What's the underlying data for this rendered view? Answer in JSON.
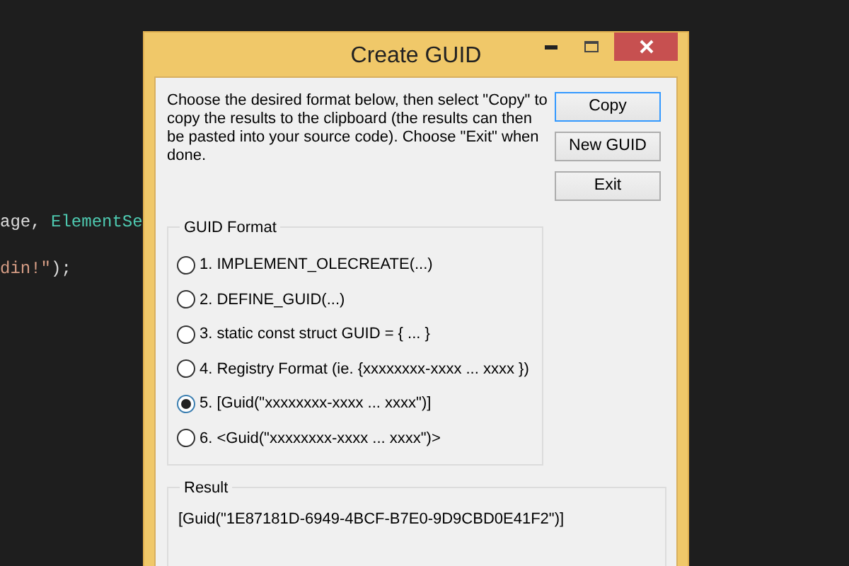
{
  "editor": {
    "lines": [
      {
        "parts": [
          {
            "kind": "plain",
            "text": "age, "
          },
          {
            "kind": "type",
            "text": "ElementSe"
          }
        ]
      },
      {
        "parts": [
          {
            "kind": "string",
            "text": "din!\""
          },
          {
            "kind": "plain",
            "text": ");"
          }
        ]
      }
    ]
  },
  "window": {
    "title": "Create GUID"
  },
  "instructions": "Choose the desired format below, then select \"Copy\" to copy the results to the clipboard (the results can then be pasted into your source code).  Choose \"Exit\" when done.",
  "buttons": [
    {
      "label": "Copy",
      "default": true
    },
    {
      "label": "New GUID",
      "default": false
    },
    {
      "label": "Exit",
      "default": false
    }
  ],
  "guid_format": {
    "title": "GUID Format",
    "options": [
      {
        "label": "1. IMPLEMENT_OLECREATE(...)",
        "selected": false
      },
      {
        "label": "2. DEFINE_GUID(...)",
        "selected": false
      },
      {
        "label": "3. static const struct GUID = { ... }",
        "selected": false
      },
      {
        "label": "4. Registry Format (ie. {xxxxxxxx-xxxx ... xxxx })",
        "selected": false
      },
      {
        "label": "5. [Guid(\"xxxxxxxx-xxxx ... xxxx\")]",
        "selected": true
      },
      {
        "label": "6. <Guid(\"xxxxxxxx-xxxx ... xxxx\")>",
        "selected": false
      }
    ]
  },
  "result": {
    "title": "Result",
    "text": "[Guid(\"1E87181D-6949-4BCF-B7E0-9D9CBD0E41F2\")]"
  }
}
